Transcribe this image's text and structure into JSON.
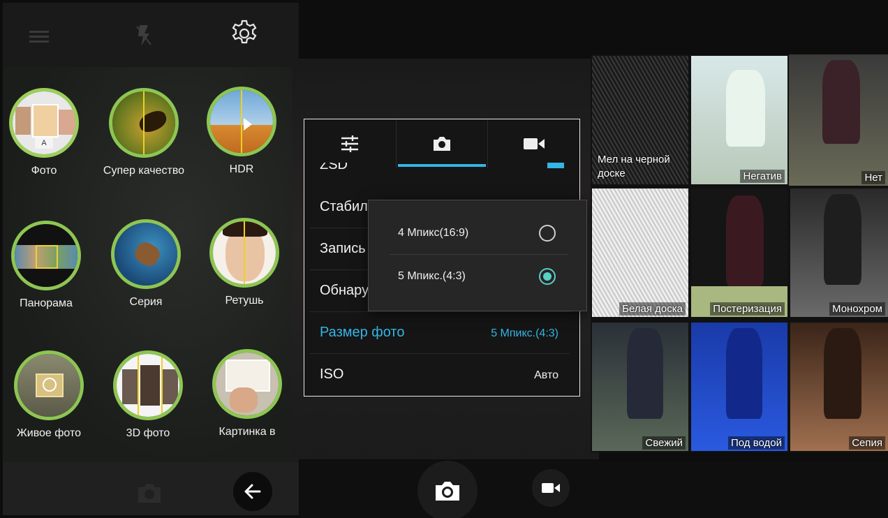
{
  "modes_panel": {
    "icons": [
      "menu-icon",
      "flash-off-icon",
      "gear-icon"
    ],
    "modes": [
      {
        "label": "Фото",
        "selected": true
      },
      {
        "label": "Супер качество"
      },
      {
        "label": "HDR"
      },
      {
        "label": "Панорама"
      },
      {
        "label": "Серия"
      },
      {
        "label": "Ретушь"
      },
      {
        "label": "Живое фото"
      },
      {
        "label": "3D фото"
      },
      {
        "label": "Картинка в"
      }
    ],
    "photo_badge": "A"
  },
  "settings": {
    "tabs": [
      {
        "icon": "sliders-icon"
      },
      {
        "icon": "camera-icon",
        "active": true
      },
      {
        "icon": "video-camera-icon"
      }
    ],
    "partial_row": "ZSD",
    "rows": [
      {
        "title": "Стабилизация",
        "value": ""
      },
      {
        "title": "Запись",
        "value": ""
      },
      {
        "title": "Обнаружение",
        "value": ""
      },
      {
        "title": "Размер фото",
        "value": "5 Мпикс.(4:3)",
        "highlighted": true
      },
      {
        "title": "ISO",
        "value": "Авто"
      }
    ]
  },
  "size_popup": {
    "options": [
      {
        "label": "4 Мпикс(16:9)",
        "checked": false
      },
      {
        "label": "5 Мпикс.(4:3)",
        "checked": true
      }
    ]
  },
  "effects": [
    {
      "label": "Мел на черной доске"
    },
    {
      "label": "Негатив"
    },
    {
      "label": "Нет",
      "selected": true
    },
    {
      "label": "Белая доска"
    },
    {
      "label": "Постеризация"
    },
    {
      "label": "Монохром"
    },
    {
      "label": "Свежий"
    },
    {
      "label": "Под водой"
    },
    {
      "label": "Сепия"
    }
  ],
  "colors": {
    "accent": "#33b5e5",
    "mode_ring": "#8dc652",
    "radio_on": "#5bd0c4"
  }
}
